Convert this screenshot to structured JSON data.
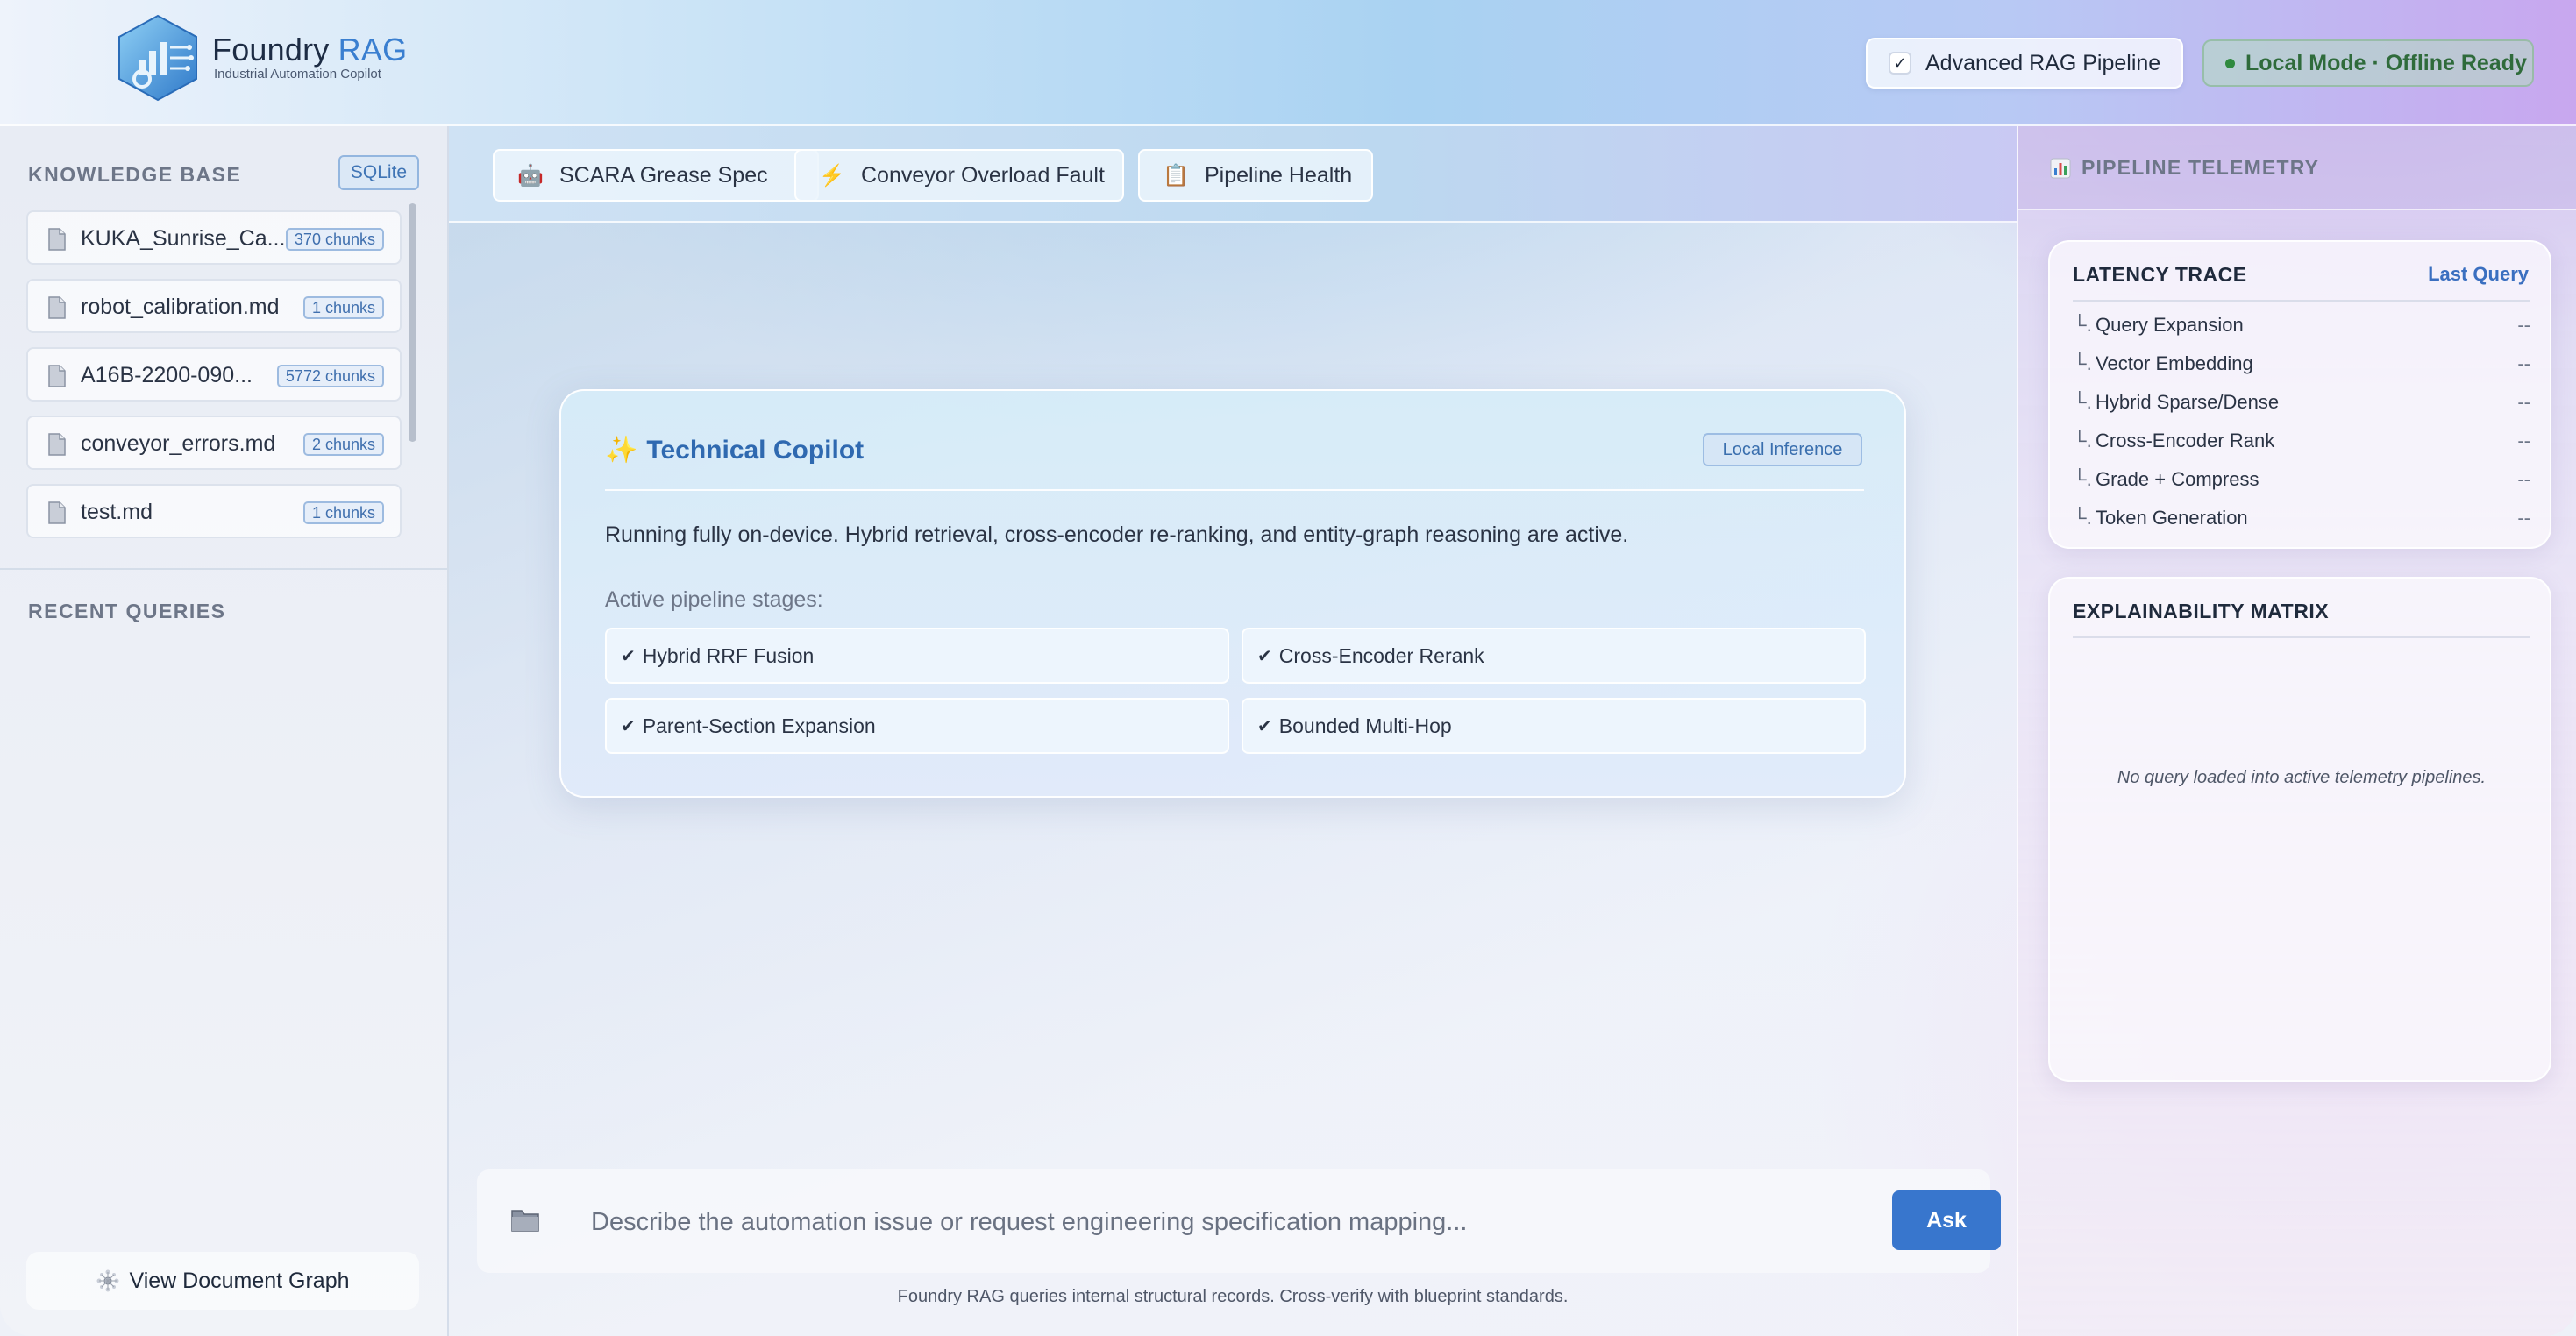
{
  "header": {
    "brand_name": "Foundry",
    "brand_accent": "RAG",
    "brand_subtitle": "Industrial Automation Copilot",
    "advanced_pipeline": {
      "label": "Advanced RAG Pipeline",
      "checked": true,
      "check_glyph": "✓"
    },
    "status_pill": "Local Mode · Offline Ready"
  },
  "sidebar": {
    "knowledge_base_title": "KNOWLEDGE BASE",
    "db_badge": "SQLite",
    "documents": [
      {
        "name": "KUKA_Sunrise_Ca...",
        "chunks": "370 chunks",
        "icon": "file-icon"
      },
      {
        "name": "robot_calibration.md",
        "chunks": "1 chunks",
        "icon": "file-icon"
      },
      {
        "name": "A16B-2200-090...",
        "chunks": "5772 chunks",
        "icon": "file-icon"
      },
      {
        "name": "conveyor_errors.md",
        "chunks": "2 chunks",
        "icon": "file-icon"
      },
      {
        "name": "test.md",
        "chunks": "1 chunks",
        "icon": "file-icon"
      }
    ],
    "recent_queries_title": "RECENT QUERIES",
    "graph_button": "View Document Graph"
  },
  "tabs": [
    {
      "label": "SCARA Grease Spec",
      "icon": "robot-icon"
    },
    {
      "label": "Conveyor Overload Fault",
      "icon": "lightning-icon"
    },
    {
      "label": "Pipeline Health",
      "icon": "clipboard-icon"
    }
  ],
  "copilot_card": {
    "sparkle": "✨",
    "title": "Technical Copilot",
    "badge": "Local Inference",
    "description": "Running fully on-device. Hybrid retrieval, cross-encoder re-ranking, and entity-graph reasoning are active.",
    "stages_label": "Active pipeline stages:",
    "stages": [
      "Hybrid RRF Fusion",
      "Cross-Encoder Rerank",
      "Parent-Section Expansion",
      "Bounded Multi-Hop"
    ],
    "check_glyph": "✔"
  },
  "composer": {
    "placeholder": "Describe the automation issue or request engineering specification mapping...",
    "value": "",
    "ask_label": "Ask",
    "disclaimer": "Foundry RAG queries internal structural records. Cross-verify with blueprint standards."
  },
  "telemetry": {
    "title": "PIPELINE TELEMETRY",
    "latency": {
      "title": "LATENCY TRACE",
      "scope": "Last Query",
      "branch_glyph": "└.",
      "rows": [
        {
          "label": "Query Expansion",
          "value": "--"
        },
        {
          "label": "Vector Embedding",
          "value": "--"
        },
        {
          "label": "Hybrid Sparse/Dense",
          "value": "--"
        },
        {
          "label": "Cross-Encoder Rank",
          "value": "--"
        },
        {
          "label": "Grade + Compress",
          "value": "--"
        },
        {
          "label": "Token Generation",
          "value": "--"
        }
      ]
    },
    "explainability": {
      "title": "EXPLAINABILITY MATRIX",
      "empty_message": "No query loaded into active telemetry pipelines."
    }
  },
  "colors": {
    "accent_blue": "#3876cd",
    "title_blue": "#2f69b0",
    "status_green": "#2f6b3b"
  }
}
